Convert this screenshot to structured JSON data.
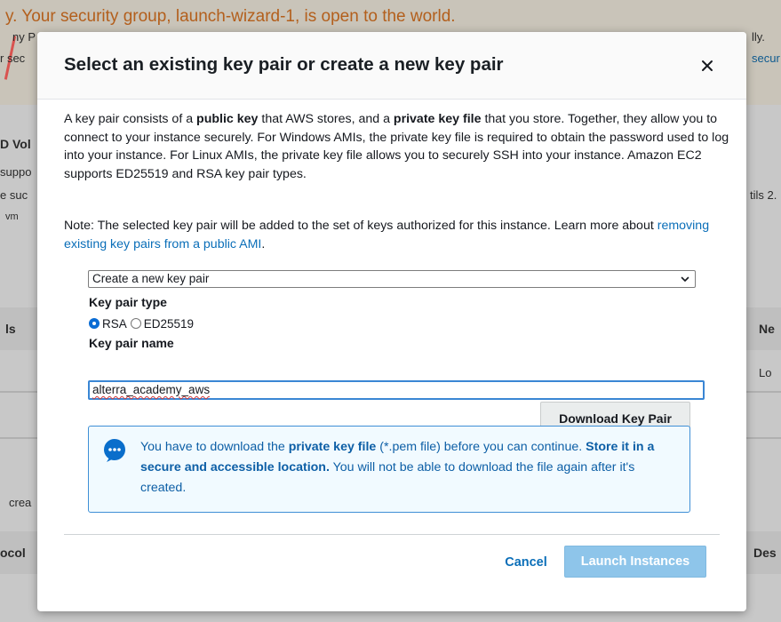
{
  "background": {
    "warning_title": "y. Your security group, launch-wizard-1, is open to the world.",
    "frag_left_1": "ny P",
    "frag_left_2": "r sec",
    "frag_right_1": "lly.",
    "frag_right_2": "secur",
    "frag_vol": "D Vol",
    "frag_suppo": "suppo",
    "frag_sud": "e suc",
    "frag_vm": "vm",
    "frag_tils": "tils 2.",
    "frag_ls": "ls",
    "frag_ne": "Ne",
    "frag_lo": "Lo",
    "frag_crea": "crea",
    "frag_ocol": "ocol",
    "frag_des": "Des"
  },
  "modal": {
    "title": "Select an existing key pair or create a new key pair",
    "close_symbol": "✕",
    "intro": {
      "part1": "A key pair consists of a ",
      "bold1": "public key",
      "part2": " that AWS stores, and a ",
      "bold2": "private key file",
      "part3": " that you store. Together, they allow you to connect to your instance securely. For Windows AMIs, the private key file is required to obtain the password used to log into your instance. For Linux AMIs, the private key file allows you to securely SSH into your instance. Amazon EC2 supports ED25519 and RSA key pair types."
    },
    "note": {
      "text": "Note: The selected key pair will be added to the set of keys authorized for this instance. Learn more about ",
      "link": "removing existing key pairs from a public AMI",
      "end": "."
    },
    "key_pair_select": {
      "value": "Create a new key pair"
    },
    "key_pair_type": {
      "label": "Key pair type",
      "options": [
        {
          "label": "RSA",
          "selected": true
        },
        {
          "label": "ED25519",
          "selected": false
        }
      ]
    },
    "key_pair_name": {
      "label": "Key pair name",
      "value": "alterra_academy_aws"
    },
    "download_button": "Download Key Pair",
    "info": {
      "part1": "You have to download the ",
      "bold1": "private key file",
      "part2": " (*.pem file) before you can continue. ",
      "bold2": "Store it in a secure and accessible location.",
      "part3": " You will not be able to download the file again after it's created."
    },
    "footer": {
      "cancel": "Cancel",
      "launch": "Launch Instances"
    }
  },
  "colors": {
    "accent_blue": "#0a6eb8",
    "info_border": "#3f8fd6",
    "info_bg": "#f1faff",
    "launch_disabled": "#8ec5ea",
    "warning_orange": "#b35f1c"
  }
}
